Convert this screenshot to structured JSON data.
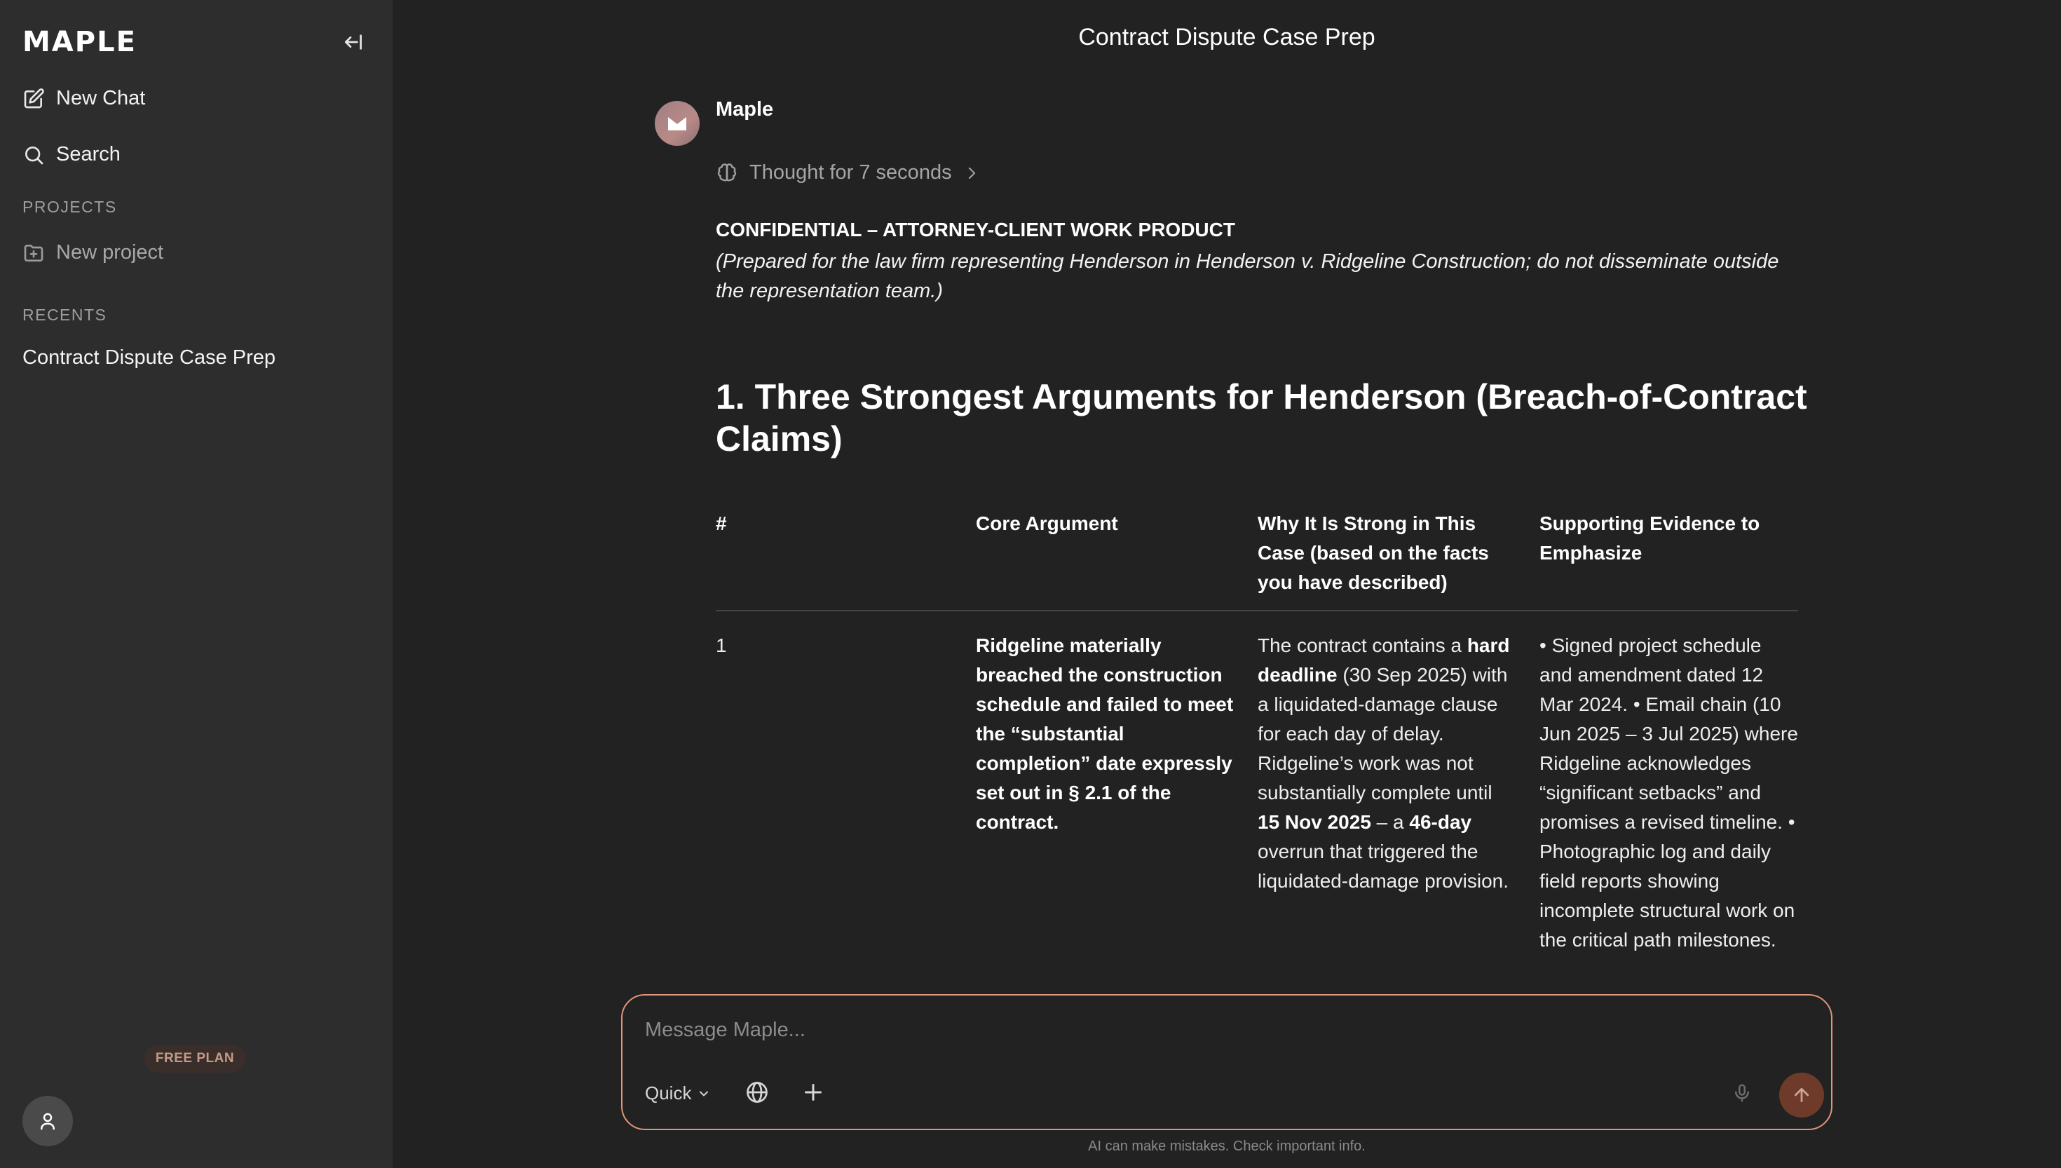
{
  "app": {
    "logo": "MAPLE"
  },
  "sidebar": {
    "new_chat": "New Chat",
    "search": "Search",
    "projects_label": "PROJECTS",
    "new_project": "New project",
    "recents_label": "RECENTS",
    "recents": [
      "Contract Dispute Case Prep"
    ],
    "plan_badge": "FREE PLAN"
  },
  "chat": {
    "title": "Contract Dispute Case Prep",
    "sender": "Maple",
    "thought": "Thought for 7 seconds",
    "confidential_title": "CONFIDENTIAL – ATTORNEY-CLIENT WORK PRODUCT",
    "confidential_note": "(Prepared for the law firm representing Henderson in Henderson v. Ridgeline Construction; do not disseminate outside the representation team.)",
    "section_heading": "1. Three Strongest Arguments for Henderson (Breach-of-Contract Claims)",
    "table": {
      "headers": [
        "#",
        "Core Argument",
        "Why It Is Strong in This Case (based on the facts you have described)",
        "Supporting Evidence to Emphasize"
      ],
      "row1": {
        "num": "1",
        "argument": "Ridgeline materially breached the construction schedule and failed to meet the “substantial completion” date expressly set out in § 2.1 of the contract.",
        "why_a": "The contract contains a ",
        "why_b": "hard deadline",
        "why_c": " (30 Sep 2025) with a liquidated-damage clause for each day of delay. Ridgeline’s work was not substantially complete until ",
        "why_d": "15 Nov 2025",
        "why_e": " – a ",
        "why_f": "46-day",
        "why_g": " overrun that triggered the liquidated-damage provision.",
        "evidence": "• Signed project schedule and amendment dated 12 Mar 2024. • Email chain (10 Jun 2025 – 3 Jul 2025) where Ridgeline acknowledges “significant setbacks” and promises a revised timeline. • Photographic log and daily field reports showing incomplete structural work on the critical path milestones."
      }
    }
  },
  "composer": {
    "placeholder": "Message Maple...",
    "mode": "Quick",
    "disclaimer": "AI can make mistakes. Check important info."
  }
}
